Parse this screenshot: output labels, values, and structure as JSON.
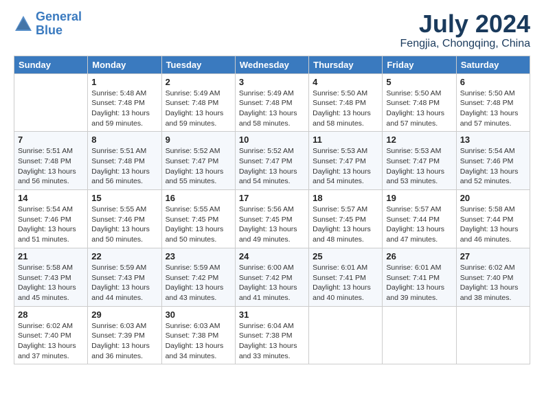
{
  "header": {
    "logo_line1": "General",
    "logo_line2": "Blue",
    "month": "July 2024",
    "location": "Fengjia, Chongqing, China"
  },
  "weekdays": [
    "Sunday",
    "Monday",
    "Tuesday",
    "Wednesday",
    "Thursday",
    "Friday",
    "Saturday"
  ],
  "weeks": [
    [
      {
        "day": "",
        "info": ""
      },
      {
        "day": "1",
        "info": "Sunrise: 5:48 AM\nSunset: 7:48 PM\nDaylight: 13 hours\nand 59 minutes."
      },
      {
        "day": "2",
        "info": "Sunrise: 5:49 AM\nSunset: 7:48 PM\nDaylight: 13 hours\nand 59 minutes."
      },
      {
        "day": "3",
        "info": "Sunrise: 5:49 AM\nSunset: 7:48 PM\nDaylight: 13 hours\nand 58 minutes."
      },
      {
        "day": "4",
        "info": "Sunrise: 5:50 AM\nSunset: 7:48 PM\nDaylight: 13 hours\nand 58 minutes."
      },
      {
        "day": "5",
        "info": "Sunrise: 5:50 AM\nSunset: 7:48 PM\nDaylight: 13 hours\nand 57 minutes."
      },
      {
        "day": "6",
        "info": "Sunrise: 5:50 AM\nSunset: 7:48 PM\nDaylight: 13 hours\nand 57 minutes."
      }
    ],
    [
      {
        "day": "7",
        "info": "Sunrise: 5:51 AM\nSunset: 7:48 PM\nDaylight: 13 hours\nand 56 minutes."
      },
      {
        "day": "8",
        "info": "Sunrise: 5:51 AM\nSunset: 7:48 PM\nDaylight: 13 hours\nand 56 minutes."
      },
      {
        "day": "9",
        "info": "Sunrise: 5:52 AM\nSunset: 7:47 PM\nDaylight: 13 hours\nand 55 minutes."
      },
      {
        "day": "10",
        "info": "Sunrise: 5:52 AM\nSunset: 7:47 PM\nDaylight: 13 hours\nand 54 minutes."
      },
      {
        "day": "11",
        "info": "Sunrise: 5:53 AM\nSunset: 7:47 PM\nDaylight: 13 hours\nand 54 minutes."
      },
      {
        "day": "12",
        "info": "Sunrise: 5:53 AM\nSunset: 7:47 PM\nDaylight: 13 hours\nand 53 minutes."
      },
      {
        "day": "13",
        "info": "Sunrise: 5:54 AM\nSunset: 7:46 PM\nDaylight: 13 hours\nand 52 minutes."
      }
    ],
    [
      {
        "day": "14",
        "info": "Sunrise: 5:54 AM\nSunset: 7:46 PM\nDaylight: 13 hours\nand 51 minutes."
      },
      {
        "day": "15",
        "info": "Sunrise: 5:55 AM\nSunset: 7:46 PM\nDaylight: 13 hours\nand 50 minutes."
      },
      {
        "day": "16",
        "info": "Sunrise: 5:55 AM\nSunset: 7:45 PM\nDaylight: 13 hours\nand 50 minutes."
      },
      {
        "day": "17",
        "info": "Sunrise: 5:56 AM\nSunset: 7:45 PM\nDaylight: 13 hours\nand 49 minutes."
      },
      {
        "day": "18",
        "info": "Sunrise: 5:57 AM\nSunset: 7:45 PM\nDaylight: 13 hours\nand 48 minutes."
      },
      {
        "day": "19",
        "info": "Sunrise: 5:57 AM\nSunset: 7:44 PM\nDaylight: 13 hours\nand 47 minutes."
      },
      {
        "day": "20",
        "info": "Sunrise: 5:58 AM\nSunset: 7:44 PM\nDaylight: 13 hours\nand 46 minutes."
      }
    ],
    [
      {
        "day": "21",
        "info": "Sunrise: 5:58 AM\nSunset: 7:43 PM\nDaylight: 13 hours\nand 45 minutes."
      },
      {
        "day": "22",
        "info": "Sunrise: 5:59 AM\nSunset: 7:43 PM\nDaylight: 13 hours\nand 44 minutes."
      },
      {
        "day": "23",
        "info": "Sunrise: 5:59 AM\nSunset: 7:42 PM\nDaylight: 13 hours\nand 43 minutes."
      },
      {
        "day": "24",
        "info": "Sunrise: 6:00 AM\nSunset: 7:42 PM\nDaylight: 13 hours\nand 41 minutes."
      },
      {
        "day": "25",
        "info": "Sunrise: 6:01 AM\nSunset: 7:41 PM\nDaylight: 13 hours\nand 40 minutes."
      },
      {
        "day": "26",
        "info": "Sunrise: 6:01 AM\nSunset: 7:41 PM\nDaylight: 13 hours\nand 39 minutes."
      },
      {
        "day": "27",
        "info": "Sunrise: 6:02 AM\nSunset: 7:40 PM\nDaylight: 13 hours\nand 38 minutes."
      }
    ],
    [
      {
        "day": "28",
        "info": "Sunrise: 6:02 AM\nSunset: 7:40 PM\nDaylight: 13 hours\nand 37 minutes."
      },
      {
        "day": "29",
        "info": "Sunrise: 6:03 AM\nSunset: 7:39 PM\nDaylight: 13 hours\nand 36 minutes."
      },
      {
        "day": "30",
        "info": "Sunrise: 6:03 AM\nSunset: 7:38 PM\nDaylight: 13 hours\nand 34 minutes."
      },
      {
        "day": "31",
        "info": "Sunrise: 6:04 AM\nSunset: 7:38 PM\nDaylight: 13 hours\nand 33 minutes."
      },
      {
        "day": "",
        "info": ""
      },
      {
        "day": "",
        "info": ""
      },
      {
        "day": "",
        "info": ""
      }
    ]
  ]
}
